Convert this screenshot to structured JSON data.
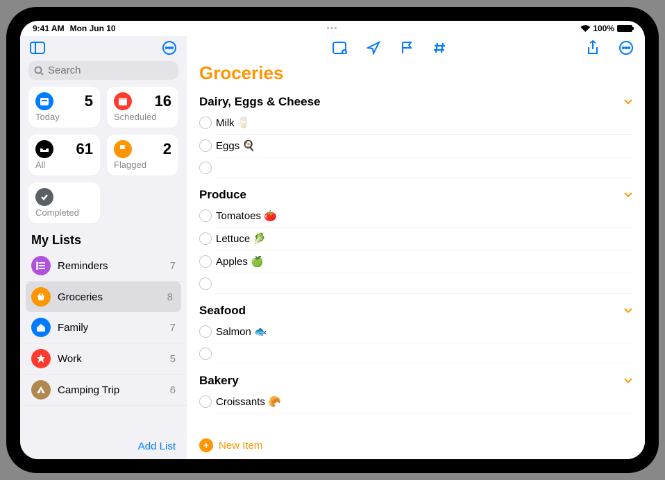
{
  "status": {
    "time": "9:41 AM",
    "date": "Mon Jun 10",
    "battery": "100%"
  },
  "search": {
    "placeholder": "Search"
  },
  "cards": {
    "today": {
      "label": "Today",
      "count": 5
    },
    "scheduled": {
      "label": "Scheduled",
      "count": 16
    },
    "all": {
      "label": "All",
      "count": 61
    },
    "flagged": {
      "label": "Flagged",
      "count": 2
    },
    "completed": {
      "label": "Completed"
    }
  },
  "sidebar": {
    "header": "My Lists",
    "lists": [
      {
        "name": "Reminders",
        "count": 7,
        "color": "#af52de",
        "icon": "list"
      },
      {
        "name": "Groceries",
        "count": 8,
        "color": "#ff9500",
        "icon": "basket"
      },
      {
        "name": "Family",
        "count": 7,
        "color": "#007aff",
        "icon": "home"
      },
      {
        "name": "Work",
        "count": 5,
        "color": "#ff3b30",
        "icon": "star"
      },
      {
        "name": "Camping Trip",
        "count": 6,
        "color": "#b08850",
        "icon": "tent"
      }
    ],
    "add_list": "Add List"
  },
  "main": {
    "title": "Groceries",
    "new_item": "New Item",
    "sections": [
      {
        "title": "Dairy, Eggs & Cheese",
        "items": [
          "Milk 🥛",
          "Eggs 🍳"
        ],
        "empty_slot": true
      },
      {
        "title": "Produce",
        "items": [
          "Tomatoes 🍅",
          "Lettuce 🥬",
          "Apples 🍏"
        ],
        "empty_slot": true
      },
      {
        "title": "Seafood",
        "items": [
          "Salmon 🐟"
        ],
        "empty_slot": true
      },
      {
        "title": "Bakery",
        "items": [
          "Croissants 🥐"
        ],
        "empty_slot": false
      }
    ]
  }
}
